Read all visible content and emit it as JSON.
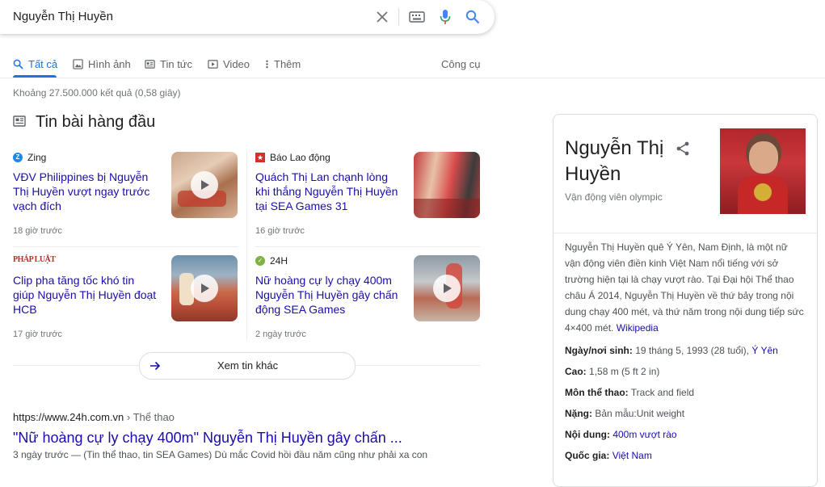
{
  "search": {
    "query": "Nguyễn Thị Huyền"
  },
  "tabs": [
    {
      "label": "Tất cả",
      "icon": "search-icon"
    },
    {
      "label": "Hình ảnh",
      "icon": "image-icon"
    },
    {
      "label": "Tin tức",
      "icon": "news-icon"
    },
    {
      "label": "Video",
      "icon": "video-icon"
    },
    {
      "label": "Thêm",
      "icon": "more-vert-icon"
    }
  ],
  "tools_label": "Công cụ",
  "result_stats": "Khoảng 27.500.000 kết quả (0,58 giây)",
  "top_stories": {
    "title": "Tin bài hàng đầu",
    "cards": [
      {
        "source": "Zing",
        "title": "VĐV Philippines bị Nguyễn Thị Huyền vượt ngay trước vạch đích",
        "time": "18 giờ trước"
      },
      {
        "source": "Báo Lao động",
        "title": "Quách Thị Lan chạnh lòng khi thắng Nguyễn Thị Huyền tại SEA Games 31",
        "time": "16 giờ trước"
      },
      {
        "source": "PHÁP LUẬT",
        "title": "Clip pha tăng tốc khó tin giúp Nguyễn Thị Huyền đoạt HCB",
        "time": "17 giờ trước"
      },
      {
        "source": "24H",
        "title": "Nữ hoàng cự ly chạy 400m Nguyễn Thị Huyền gây chấn động SEA Games",
        "time": "2 ngày trước"
      }
    ],
    "more_label": "Xem tin khác"
  },
  "result": {
    "url": "https://www.24h.com.vn",
    "breadcrumb": " › Thể thao",
    "title": "\"Nữ hoàng cự ly chạy 400m\" Nguyễn Thị Huyền gây chấn ...",
    "snippet": "3 ngày trước — (Tin thể thao, tin SEA Games) Dù mắc Covid hồi đầu năm cũng như phải xa con"
  },
  "knowledge_panel": {
    "name": "Nguyễn Thị Huyền",
    "subtitle": "Vận động viên olympic",
    "description": "Nguyễn Thị Huyền quê Ý Yên, Nam Định, là một nữ vận động viên điền kinh Việt Nam nổi tiếng với sở trường hiện tại là chạy vượt rào. Tại Đại hội Thể thao châu Á 2014, Nguyễn Thị Huyền về thứ bảy trong nội dung chạy 400 mét, và thứ năm trong nội dung tiếp sức 4×400 mét.",
    "wiki_label": "Wikipedia",
    "facts": [
      {
        "label": "Ngày/nơi sinh:",
        "value": "19 tháng 5, 1993 (28 tuổi), ",
        "link": "Ý Yên"
      },
      {
        "label": "Cao:",
        "value": "1,58 m (5 ft 2 in)",
        "link": ""
      },
      {
        "label": "Môn thể thao:",
        "value": "Track and field",
        "link": ""
      },
      {
        "label": "Nặng:",
        "value": "Bản mẫu:Unit weight",
        "link": ""
      },
      {
        "label": "Nội dung:",
        "value": "",
        "link": "400m vượt rào"
      },
      {
        "label": "Quốc gia:",
        "value": "",
        "link": "Việt Nam"
      }
    ]
  },
  "colors": {
    "accent": "#1a73e8",
    "link": "#1a0dab"
  }
}
